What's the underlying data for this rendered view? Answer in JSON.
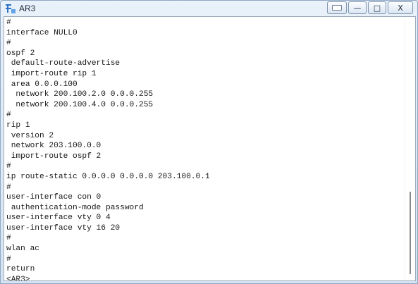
{
  "window": {
    "title": "AR3",
    "icon": "network-terminal-icon"
  },
  "window_controls": {
    "extra_label": "",
    "minimize_label": "—",
    "maximize_label": "□",
    "close_label": "X"
  },
  "console": {
    "lines": [
      "#",
      "interface NULL0",
      "#",
      "ospf 2",
      " default-route-advertise",
      " import-route rip 1",
      " area 0.0.0.100",
      "  network 200.100.2.0 0.0.0.255",
      "  network 200.100.4.0 0.0.0.255",
      "#",
      "rip 1",
      " version 2",
      " network 203.100.0.0",
      " import-route ospf 2",
      "#",
      "ip route-static 0.0.0.0 0.0.0.0 203.100.0.1",
      "#",
      "user-interface con 0",
      " authentication-mode password",
      "user-interface vty 0 4",
      "user-interface vty 16 20",
      "#",
      "wlan ac",
      "#",
      "return",
      "<AR3>"
    ]
  },
  "scrollbar": {
    "position_fraction": 0.66,
    "visible_fraction": 0.31
  },
  "colors": {
    "title_bg_top": "#e9f1fa",
    "title_bg_bottom": "#d5e3f2",
    "console_bg": "#ffffff",
    "console_text": "#1a1a1a",
    "scroll_thumb": "#8a8a8a"
  }
}
